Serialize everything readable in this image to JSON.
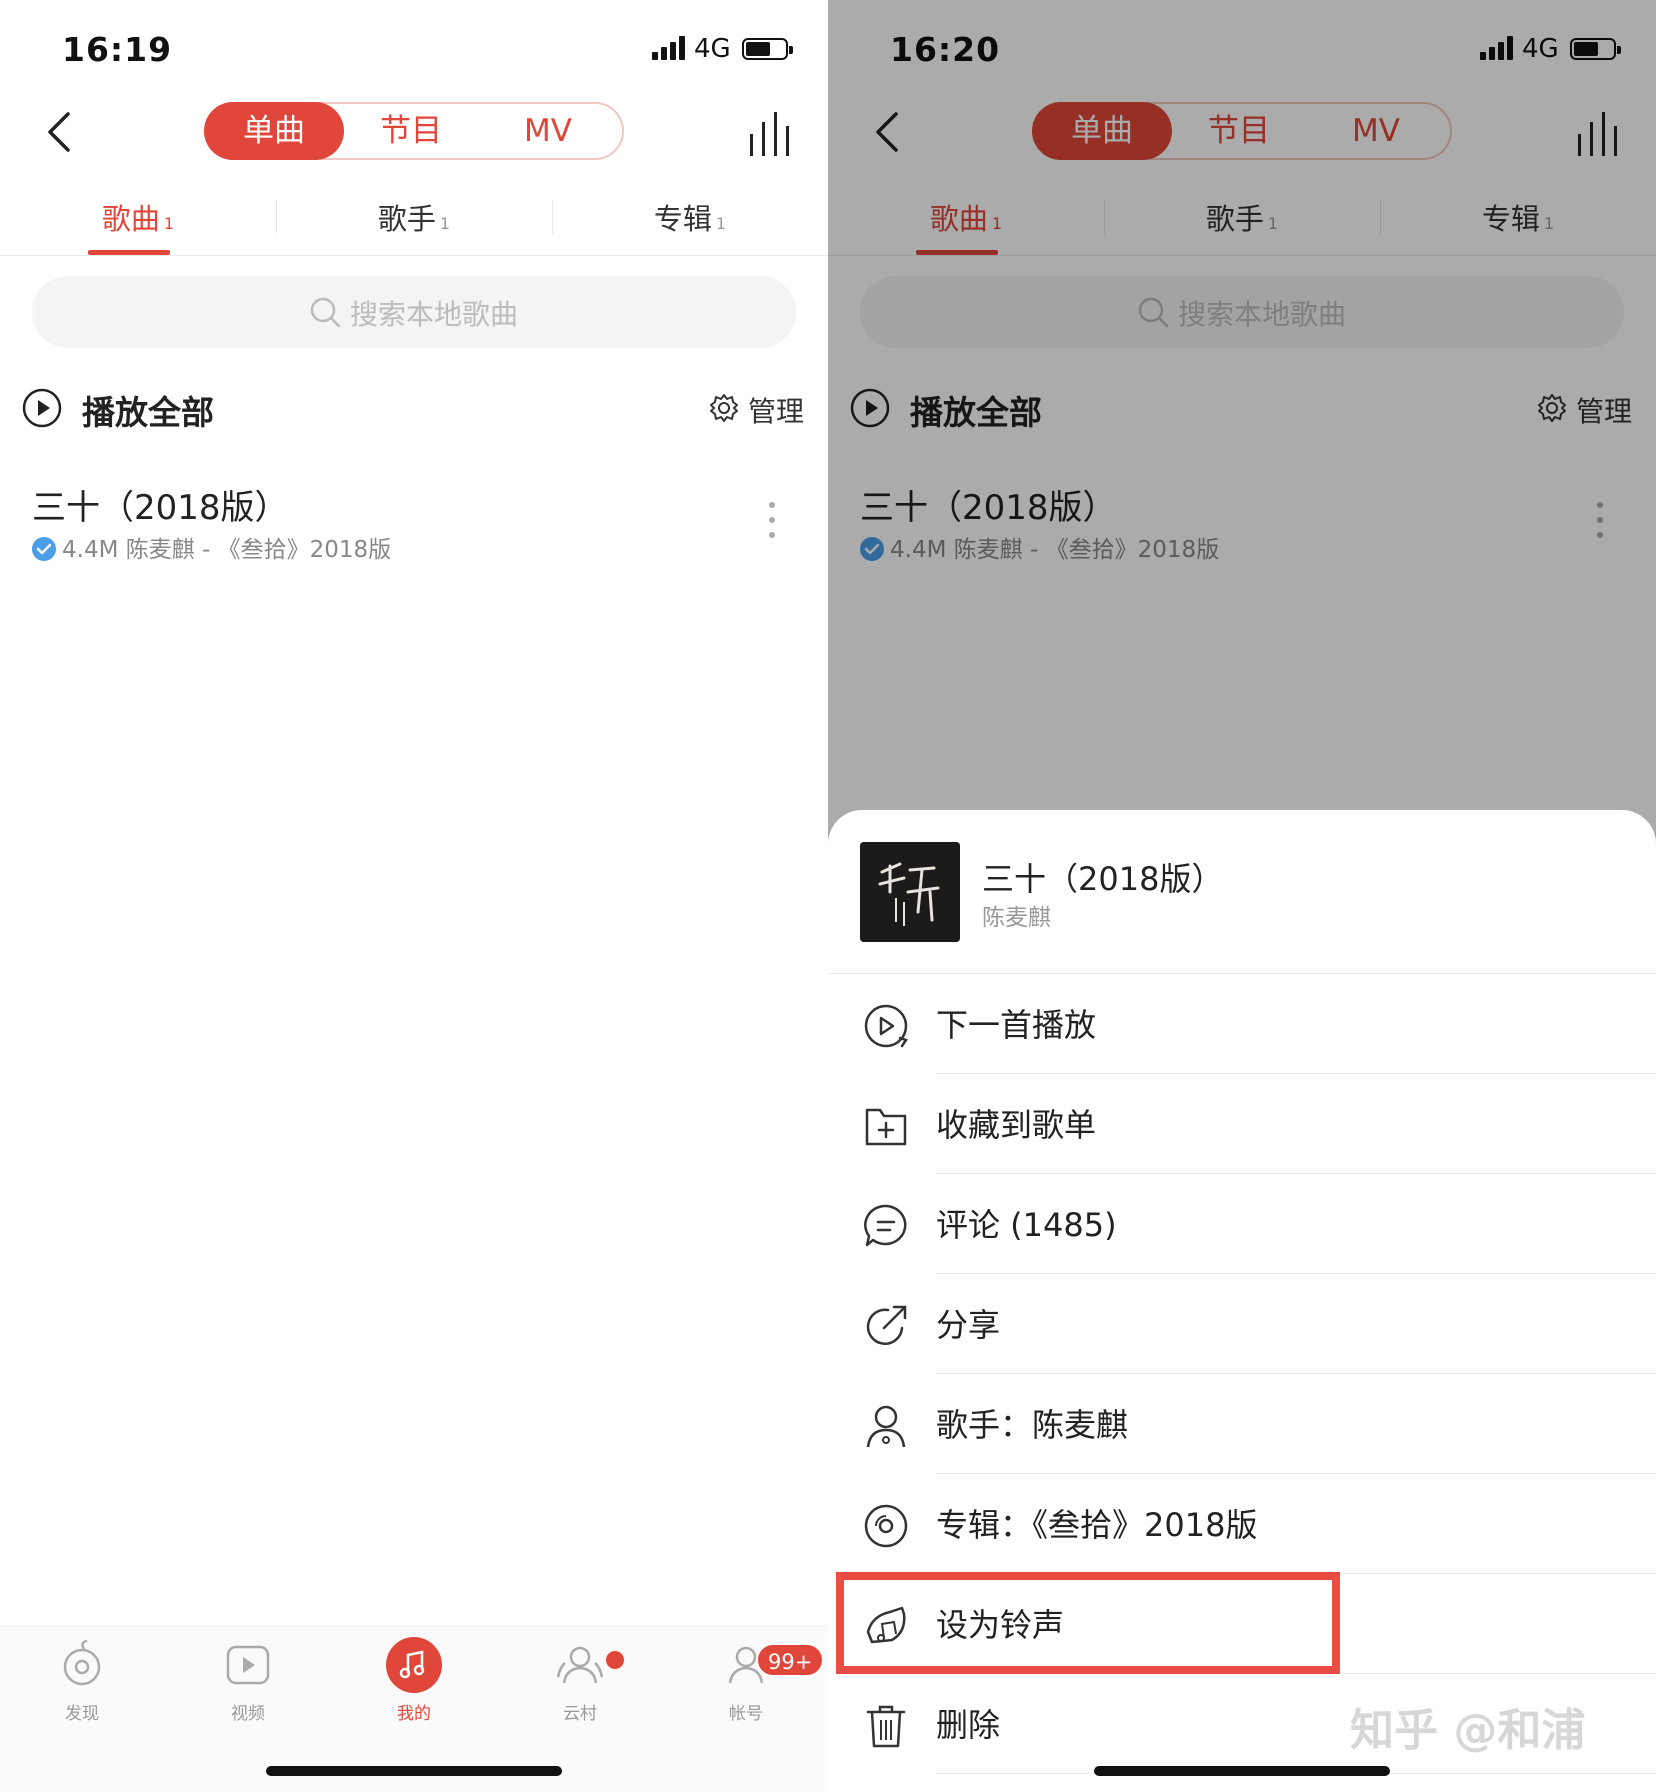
{
  "status_left": {
    "time": "16:19",
    "network": "4G"
  },
  "status_right": {
    "time": "16:20",
    "network": "4G"
  },
  "segment_tabs": [
    "单曲",
    "节目",
    "MV"
  ],
  "category_tabs": [
    {
      "label": "歌曲",
      "count": "1"
    },
    {
      "label": "歌手",
      "count": "1"
    },
    {
      "label": "专辑",
      "count": "1"
    }
  ],
  "search": {
    "placeholder": "搜索本地歌曲"
  },
  "play_all": {
    "label": "播放全部",
    "manage": "管理"
  },
  "song": {
    "title": "三十（2018版）",
    "meta": "4.4M 陈麦麒 - 《叁拾》2018版"
  },
  "bottom_tabs": [
    {
      "label": "发现",
      "icon": "discover-icon"
    },
    {
      "label": "视频",
      "icon": "video-icon"
    },
    {
      "label": "我的",
      "icon": "music-note-icon"
    },
    {
      "label": "云村",
      "icon": "community-icon"
    },
    {
      "label": "帐号",
      "icon": "account-icon",
      "badge": "99+"
    }
  ],
  "sheet": {
    "song_title": "三十（2018版）",
    "artist": "陈麦麒",
    "actions": [
      {
        "label": "下一首播放",
        "icon": "play-next-icon"
      },
      {
        "label": "收藏到歌单",
        "icon": "add-to-playlist-icon"
      },
      {
        "label": "评论 (1485)",
        "icon": "comment-icon"
      },
      {
        "label": "分享",
        "icon": "share-icon"
      },
      {
        "label": "歌手：陈麦麒",
        "icon": "artist-icon"
      },
      {
        "label": "专辑：《叁拾》2018版",
        "icon": "album-icon"
      },
      {
        "label": "设为铃声",
        "icon": "ringtone-icon"
      },
      {
        "label": "删除",
        "icon": "delete-icon"
      }
    ]
  },
  "watermark": "知乎 @和浦",
  "colors": {
    "accent": "#e0463a",
    "highlight": "#ea4b43"
  }
}
